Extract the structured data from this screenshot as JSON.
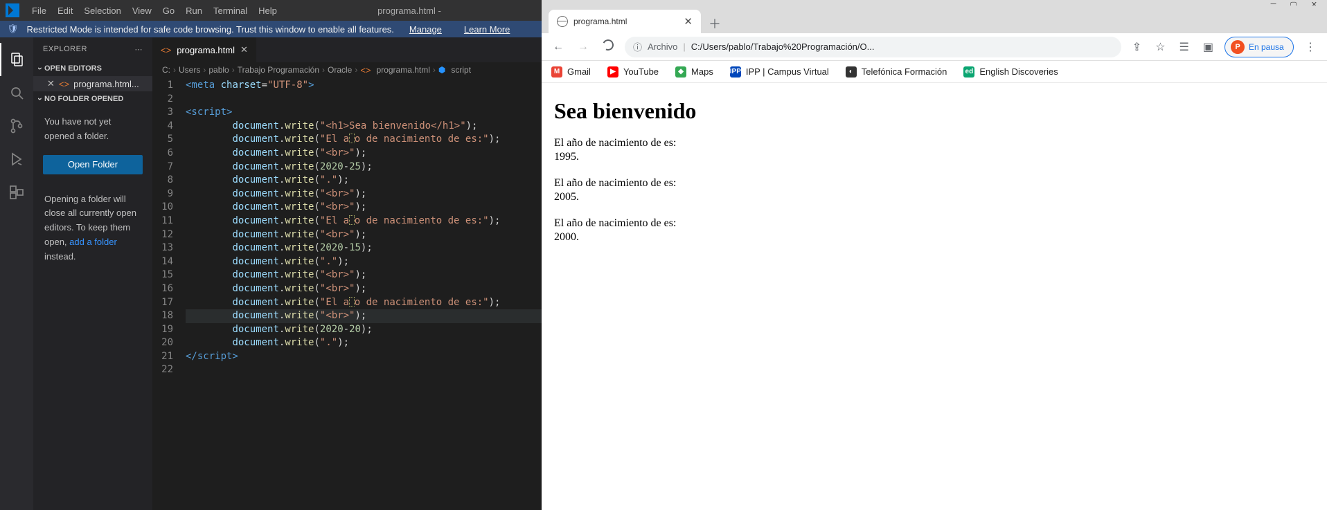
{
  "vscode": {
    "menu": [
      "File",
      "Edit",
      "Selection",
      "View",
      "Go",
      "Run",
      "Terminal",
      "Help"
    ],
    "window_title": "programa.html -",
    "restricted": {
      "text": "Restricted Mode is intended for safe code browsing. Trust this window to enable all features.",
      "manage": "Manage",
      "learn": "Learn More"
    },
    "sidebar": {
      "header": "EXPLORER",
      "open_editors": "OPEN EDITORS",
      "open_editor_item": "programa.html...",
      "no_folder": "NO FOLDER OPENED",
      "msg1": "You have not yet opened a folder.",
      "open_folder_btn": "Open Folder",
      "msg2a": "Opening a folder will close all currently open editors. To keep them open, ",
      "msg2_link": "add a folder",
      "msg2b": " instead."
    },
    "tab": "programa.html",
    "breadcrumbs": [
      "C:",
      "Users",
      "pablo",
      "Trabajo Programación",
      "Oracle",
      "programa.html",
      "script"
    ],
    "code": {
      "line_count": 22,
      "lines": [
        {
          "n": 1,
          "type": "meta",
          "parts": [
            "<",
            "meta",
            " ",
            "charset",
            "=",
            "\"UTF-8\"",
            ">"
          ]
        },
        {
          "n": 2,
          "type": "blank"
        },
        {
          "n": 3,
          "type": "open",
          "parts": [
            "<",
            "script",
            ">"
          ]
        },
        {
          "n": 4,
          "type": "write_str",
          "value": "<h1>Sea bienvenido</h1>"
        },
        {
          "n": 5,
          "type": "write_str_box",
          "value_pre": "El a",
          "value_post": "o de nacimiento de es:"
        },
        {
          "n": 6,
          "type": "write_str",
          "value": "<br>"
        },
        {
          "n": 7,
          "type": "write_expr",
          "expr": "2020-25"
        },
        {
          "n": 8,
          "type": "write_str",
          "value": "."
        },
        {
          "n": 9,
          "type": "write_str",
          "value": "<br>"
        },
        {
          "n": 10,
          "type": "write_str",
          "value": "<br>"
        },
        {
          "n": 11,
          "type": "write_str_box",
          "value_pre": "El a",
          "value_post": "o de nacimiento de es:"
        },
        {
          "n": 12,
          "type": "write_str",
          "value": "<br>"
        },
        {
          "n": 13,
          "type": "write_expr",
          "expr": "2020-15"
        },
        {
          "n": 14,
          "type": "write_str",
          "value": "."
        },
        {
          "n": 15,
          "type": "write_str",
          "value": "<br>"
        },
        {
          "n": 16,
          "type": "write_str",
          "value": "<br>"
        },
        {
          "n": 17,
          "type": "write_str_box",
          "value_pre": "El a",
          "value_post": "o de nacimiento de es:"
        },
        {
          "n": 18,
          "type": "write_str",
          "value": "<br>",
          "hl": true
        },
        {
          "n": 19,
          "type": "write_expr",
          "expr": "2020-20"
        },
        {
          "n": 20,
          "type": "write_str",
          "value": "."
        },
        {
          "n": 21,
          "type": "close",
          "parts": [
            "</",
            "script",
            ">"
          ]
        },
        {
          "n": 22,
          "type": "blank"
        }
      ]
    }
  },
  "browser": {
    "tab_title": "programa.html",
    "address_prefix": "Archivo",
    "address": "C:/Users/pablo/Trabajo%20Programación/O...",
    "avatar_letter": "P",
    "pause": "En pausa",
    "bookmarks": [
      {
        "label": "Gmail",
        "color": "#ea4335",
        "glyph": "M"
      },
      {
        "label": "YouTube",
        "color": "#ff0000",
        "glyph": "▶"
      },
      {
        "label": "Maps",
        "color": "#34a853",
        "glyph": "◆"
      },
      {
        "label": "IPP | Campus Virtual",
        "color": "#0046ba",
        "glyph": "IPP"
      },
      {
        "label": "Telefónica Formación",
        "color": "#333",
        "glyph": "◐"
      },
      {
        "label": "English Discoveries",
        "color": "#0aa571",
        "glyph": "ed"
      }
    ],
    "page": {
      "h1": "Sea bienvenido",
      "blocks": [
        [
          "El año de nacimiento de es:",
          "1995."
        ],
        [
          "El año de nacimiento de es:",
          "2005."
        ],
        [
          "El año de nacimiento de es:",
          "2000."
        ]
      ]
    }
  }
}
